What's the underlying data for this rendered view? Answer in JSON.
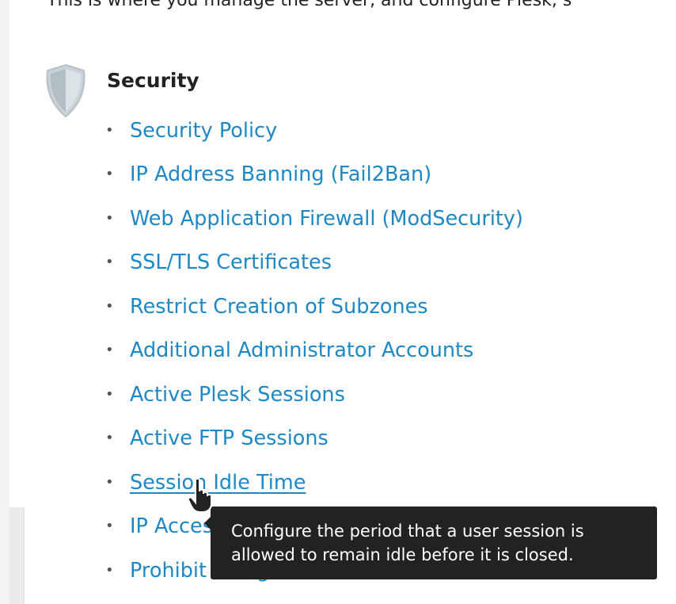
{
  "intro": {
    "text": "This is where you manage the server, and configure Plesk, s"
  },
  "security": {
    "title": "Security",
    "icon": "shield-icon",
    "links": [
      {
        "label": "Security Policy"
      },
      {
        "label": "IP Address Banning (Fail2Ban)"
      },
      {
        "label": "Web Application Firewall (ModSecurity)"
      },
      {
        "label": "SSL/TLS Certificates"
      },
      {
        "label": "Restrict Creation of Subzones"
      },
      {
        "label": "Additional Administrator Accounts"
      },
      {
        "label": "Active Plesk Sessions"
      },
      {
        "label": "Active FTP Sessions"
      },
      {
        "label": "Session Idle Time",
        "hovered": true
      },
      {
        "label": "IP Access Restriction Management"
      },
      {
        "label": "Prohibit Using Weak Passwords"
      }
    ]
  },
  "tooltip": {
    "line1": "Configure the period that a user session is",
    "line2": "allowed to remain idle before it is closed."
  },
  "colors": {
    "link": "#1e88c5",
    "text": "#222222",
    "tooltip_bg": "#222222",
    "shield": "#cfd8dc"
  }
}
